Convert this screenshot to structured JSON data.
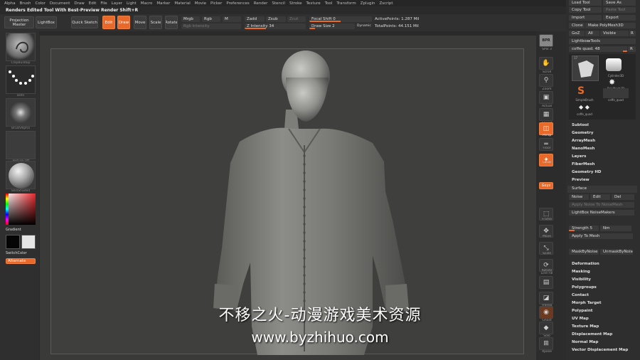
{
  "menu": [
    "Alpha",
    "Brush",
    "Color",
    "Document",
    "Draw",
    "Edit",
    "File",
    "Layer",
    "Light",
    "Macro",
    "Marker",
    "Material",
    "Movie",
    "Picker",
    "Preferences",
    "Render",
    "Stencil",
    "Stroke",
    "Texture",
    "Tool",
    "Transform",
    "Zplugin",
    "Zscript"
  ],
  "title_line": "Renders Edited Tool With Best-Preview Render   Shift+R",
  "topbar": {
    "projection_master": "Projection Master",
    "lightbox": "LightBox",
    "quick_sketch": "Quick Sketch",
    "edit": "Edit",
    "draw": "Draw",
    "move": "Move",
    "scale": "Scale",
    "rotate": "Rotate",
    "mrgb": "Mrgb",
    "rgb": "Rgb",
    "m": "M",
    "zadd": "Zadd",
    "zsub": "Zsub",
    "zcut": "Zcut",
    "rgb_intensity": "Rgb Intensity",
    "z_intensity": "Z Intensity 34",
    "focal_shift": "Focal Shift 0",
    "draw_size": "Draw Size 2",
    "dynamic": "Dynamic",
    "active_points": "ActivePoints: 1.287 Mil",
    "total_points": "TotalPoints: 44.151 Mil"
  },
  "left": {
    "brush_label": "ClayBuildup",
    "stroke_label": "Dots",
    "alpha_label": "BrushAlpha",
    "texture_label": "Texture Off",
    "material_label": "SkinShade4",
    "gradient": "Gradient",
    "switch_color": "SwitchColor",
    "alternate": "Alternate"
  },
  "right_icons": [
    {
      "icon": "BPR",
      "label": "SPix 3"
    },
    {
      "icon": "scroll-icon",
      "label": "Scroll"
    },
    {
      "icon": "zoom-icon",
      "label": "Zoom"
    },
    {
      "icon": "actual-icon",
      "label": "Actual"
    },
    {
      "icon": "aahalf-icon",
      "label": "AAHalf"
    },
    {
      "icon": "persp-icon",
      "label": "Persp"
    },
    {
      "icon": "floor-icon",
      "label": "Floor"
    },
    {
      "icon": "local-icon",
      "label": "Local"
    },
    {
      "icon": "xyz-icon",
      "label": "Gxyz"
    },
    {
      "icon": "frame-icon",
      "label": "Frame"
    },
    {
      "icon": "move-icon",
      "label": "Move"
    },
    {
      "icon": "scale-icon",
      "label": "Scale"
    },
    {
      "icon": "rotate-icon",
      "label": "Rotate"
    },
    {
      "icon": "linefill-icon",
      "label": "Line Fill"
    },
    {
      "icon": "transp-icon",
      "label": "Transp"
    },
    {
      "icon": "ghost-icon",
      "label": "Ghost"
    },
    {
      "icon": "solo-icon",
      "label": "Solo"
    },
    {
      "icon": "xpose-icon",
      "label": "Xpose"
    }
  ],
  "tool": {
    "load_tool": "Load Tool",
    "save_as": "Save As",
    "copy_tool": "Copy Tool",
    "paste_tool": "Paste Tool",
    "import": "Import",
    "export": "Export",
    "clone": "Clone",
    "make_polymesh": "Make PolyMesh3D",
    "goz": "GoZ",
    "all": "All",
    "visible": "Visible",
    "r": "R",
    "lightbox_tools": "Lightbox▸Tools",
    "current_tool": "coffe quad. 48",
    "r2": "R",
    "count": "17",
    "tool_names": [
      "",
      "Cylinder3D",
      "PolyMesh3D",
      "SimpleBrush",
      "coffe_quad",
      "coffe_quad"
    ],
    "subtool": "Subtool",
    "geometry": "Geometry",
    "arraymesh": "ArrayMesh",
    "nanomesh": "NanoMesh",
    "layers": "Layers",
    "fibermesh": "FiberMesh",
    "geometry_hd": "Geometry HD",
    "preview": "Preview",
    "surface": "Surface",
    "noise": "Noise",
    "edit": "Edit",
    "del": "Del",
    "apply_noise": "Apply Noise To NoiseMesh",
    "lightbox_noisemakers": "LightBox NoiseMakers",
    "strength": "Strength 5",
    "nm": "Nm",
    "apply_to_mesh": "Apply To Mesh",
    "mask_by_noise": "MaskByNoise",
    "unmask_by_noise": "UnmaskByNoise",
    "deformation": "Deformation",
    "masking": "Masking",
    "visibility": "Visibility",
    "polygroups": "Polygroups",
    "contact": "Contact",
    "morph_target": "Morph Target",
    "polypaint": "Polypaint",
    "uv_map": "UV Map",
    "texture_map": "Texture Map",
    "displacement_map": "Displacement Map",
    "normal_map": "Normal Map",
    "vector_displacement_map": "Vector Displacement Map"
  },
  "watermark": {
    "line1": "不移之火-动漫游戏美术资源",
    "line2": "www.byzhihuo.com"
  }
}
